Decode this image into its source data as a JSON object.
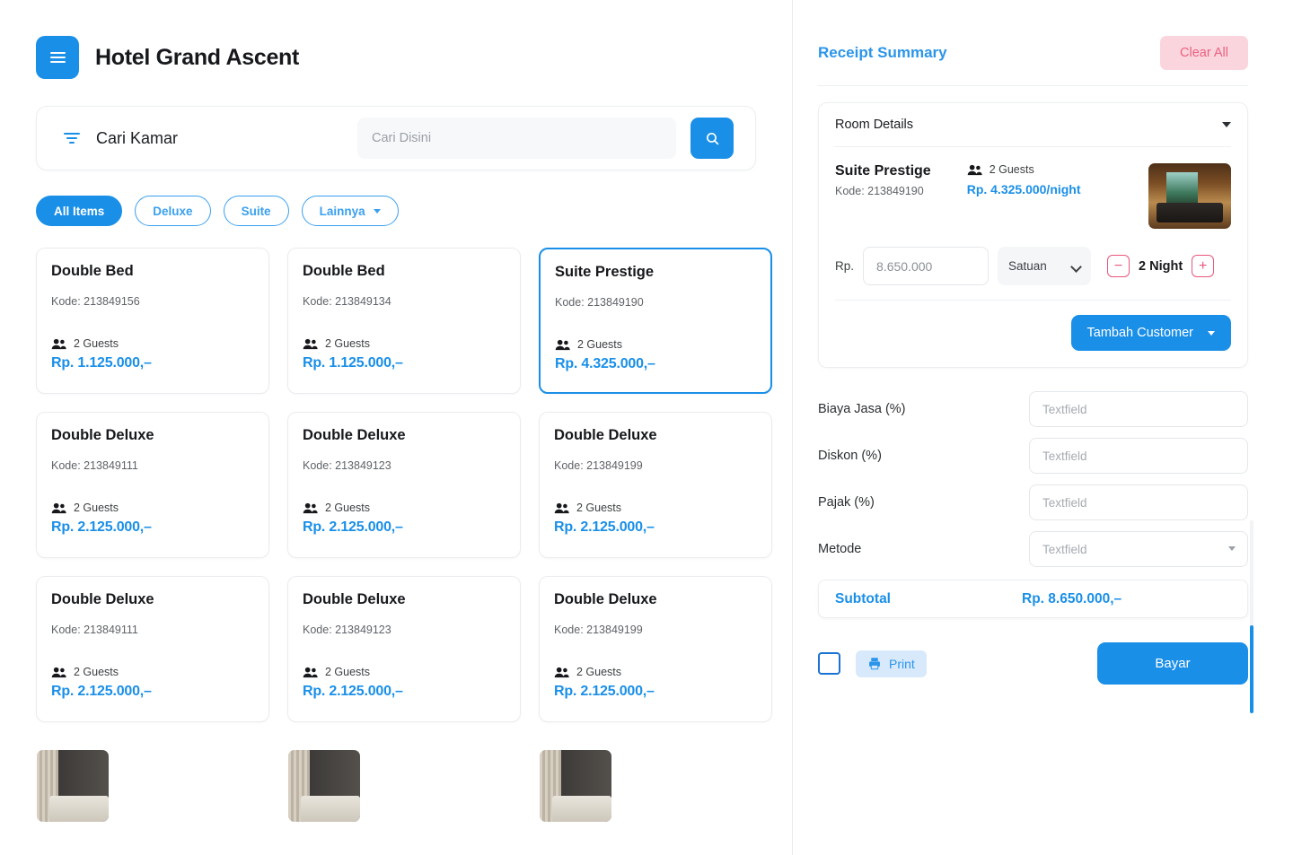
{
  "header": {
    "title": "Hotel Grand Ascent",
    "menu_icon": "hamburger-menu-icon"
  },
  "search": {
    "filter_icon": "filter-icon",
    "label": "Cari Kamar",
    "placeholder": "Cari Disini",
    "value": "",
    "button_icon": "search-icon"
  },
  "filters": [
    {
      "label": "All Items",
      "active": true,
      "has_caret": false
    },
    {
      "label": "Deluxe",
      "active": false,
      "has_caret": false
    },
    {
      "label": "Suite",
      "active": false,
      "has_caret": false
    },
    {
      "label": "Lainnya",
      "active": false,
      "has_caret": true
    }
  ],
  "rooms": [
    {
      "name": "Double Bed",
      "code": "Kode: 213849156",
      "guests": "2 Guests",
      "price": "Rp. 1.125.000,–",
      "thumb": "th-bed",
      "selected": false
    },
    {
      "name": "Double Bed",
      "code": "Kode: 213849134",
      "guests": "2 Guests",
      "price": "Rp. 1.125.000,–",
      "thumb": "th-bed",
      "selected": false
    },
    {
      "name": "Suite Prestige",
      "code": "Kode: 213849190",
      "guests": "2 Guests",
      "price": "Rp. 4.325.000,–",
      "thumb": "th-suite",
      "selected": true
    },
    {
      "name": "Double Deluxe",
      "code": "Kode: 213849111",
      "guests": "2 Guests",
      "price": "Rp. 2.125.000,–",
      "thumb": "th-deluxe",
      "selected": false
    },
    {
      "name": "Double Deluxe",
      "code": "Kode: 213849123",
      "guests": "2 Guests",
      "price": "Rp. 2.125.000,–",
      "thumb": "th-deluxe",
      "selected": false
    },
    {
      "name": "Double Deluxe",
      "code": "Kode: 213849199",
      "guests": "2 Guests",
      "price": "Rp. 2.125.000,–",
      "thumb": "th-deluxe",
      "selected": false
    },
    {
      "name": "Double Deluxe",
      "code": "Kode: 213849111",
      "guests": "2 Guests",
      "price": "Rp. 2.125.000,–",
      "thumb": "th-deluxe",
      "selected": false
    },
    {
      "name": "Double Deluxe",
      "code": "Kode: 213849123",
      "guests": "2 Guests",
      "price": "Rp. 2.125.000,–",
      "thumb": "th-deluxe",
      "selected": false
    },
    {
      "name": "Double Deluxe",
      "code": "Kode: 213849199",
      "guests": "2 Guests",
      "price": "Rp. 2.125.000,–",
      "thumb": "th-deluxe",
      "selected": false
    }
  ],
  "receipt": {
    "title": "Receipt Summary",
    "clear_all": "Clear All",
    "room_details_label": "Room Details",
    "item": {
      "name": "Suite Prestige",
      "code": "Kode: 213849190",
      "guests": "2 Guests",
      "price_per_night": "Rp. 4.325.000/night"
    },
    "amount": {
      "currency_label": "Rp.",
      "value": "",
      "placeholder": "8.650.000",
      "unit_selected": "Satuan",
      "unit_options": [
        "Satuan"
      ],
      "minus_label": "−",
      "plus_label": "+",
      "nights": "2 Night"
    },
    "add_customer": "Tambah Customer",
    "fields": [
      {
        "label": "Biaya Jasa  (%)",
        "placeholder": "Textfield",
        "value": "",
        "type": "text"
      },
      {
        "label": "Diskon (%)",
        "placeholder": "Textfield",
        "value": "",
        "type": "text"
      },
      {
        "label": "Pajak (%)",
        "placeholder": "Textfield",
        "value": "",
        "type": "text"
      },
      {
        "label": "Metode",
        "placeholder": "Textfield",
        "value": "",
        "type": "select"
      }
    ],
    "subtotal_label": "Subtotal",
    "subtotal_value": "Rp. 8.650.000,–",
    "print_label": "Print",
    "print_icon": "printer-icon",
    "checkbox_checked": false,
    "pay_label": "Bayar"
  },
  "colors": {
    "accent_blue": "#1a8fe8",
    "pink": "#e8567d",
    "clear_bg": "#fbd5dd",
    "print_bg": "#d8e9fb"
  }
}
